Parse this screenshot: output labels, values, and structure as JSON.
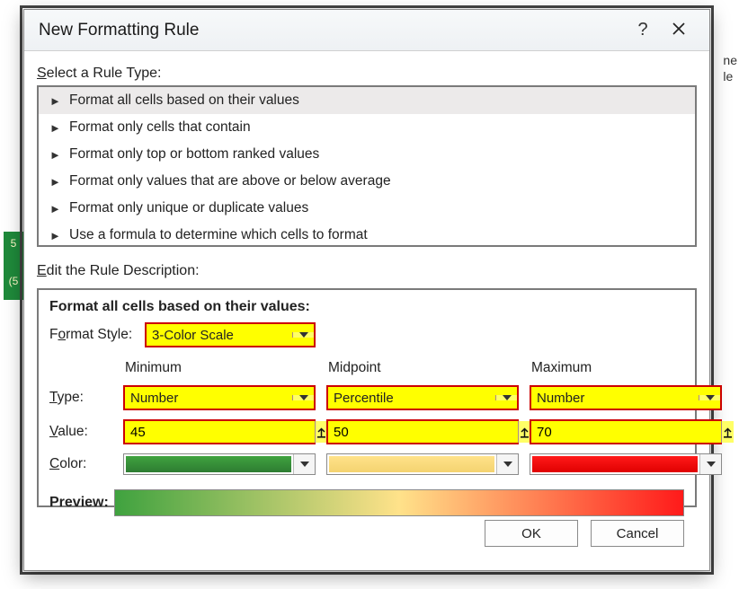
{
  "bg": {
    "side_green_top": "5",
    "side_green_bottom": "(5",
    "right1": "ne",
    "right2": "le"
  },
  "dialog": {
    "title": "New Formatting Rule",
    "section_ruletype_label_pre": "S",
    "section_ruletype_label_rest": "elect a Rule Type:",
    "rule_types": [
      "Format all cells based on their values",
      "Format only cells that contain",
      "Format only top or bottom ranked values",
      "Format only values that are above or below average",
      "Format only unique or duplicate values",
      "Use a formula to determine which cells to format"
    ],
    "selected_rule_index": 0,
    "section_edit_label_pre": "E",
    "section_edit_label_rest": "dit the Rule Description:",
    "desc_title": "Format all cells based on their values:",
    "format_style_label_pre": "F",
    "format_style_label_u": "o",
    "format_style_label_post": "rmat Style:",
    "format_style_value": "3-Color Scale",
    "col_headers": {
      "min": "Minimum",
      "mid": "Midpoint",
      "max": "Maximum"
    },
    "row_labels": {
      "type_pre": "T",
      "type_rest": "ype:",
      "value_pre": "V",
      "value_rest": "alue:",
      "color_pre": "C",
      "color_rest": "olor:"
    },
    "cells": {
      "min": {
        "type": "Number",
        "value": "45",
        "color": "#3fa23f"
      },
      "mid": {
        "type": "Percentile",
        "value": "50",
        "color": "#ffe28a"
      },
      "max": {
        "type": "Number",
        "value": "70",
        "color": "#ff1a1a"
      }
    },
    "gradient": [
      "#3fa23f",
      "#ffe28a",
      "#ff1a1a"
    ],
    "preview_label": "Preview:",
    "buttons": {
      "ok": "OK",
      "cancel": "Cancel"
    }
  },
  "chart_data": {
    "type": "table",
    "title": "3-Color Scale thresholds",
    "columns": [
      "",
      "Minimum",
      "Midpoint",
      "Maximum"
    ],
    "rows": [
      [
        "Type",
        "Number",
        "Percentile",
        "Number"
      ],
      [
        "Value",
        45,
        50,
        70
      ],
      [
        "Color",
        "#3fa23f",
        "#ffe28a",
        "#ff1a1a"
      ]
    ],
    "gradient_stops": [
      {
        "pos": 0.0,
        "color": "#3fa23f"
      },
      {
        "pos": 0.5,
        "color": "#ffe28a"
      },
      {
        "pos": 1.0,
        "color": "#ff1a1a"
      }
    ]
  }
}
